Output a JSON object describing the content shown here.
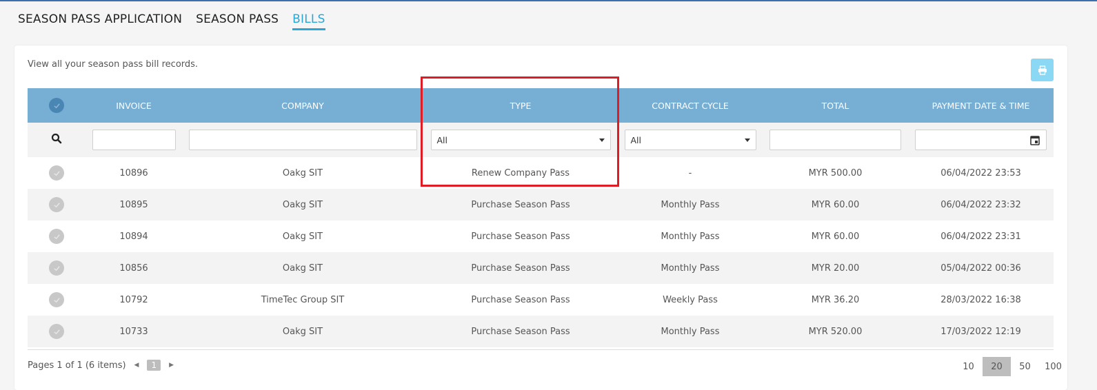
{
  "tabs": [
    {
      "label": "SEASON PASS APPLICATION",
      "active": false
    },
    {
      "label": "SEASON PASS",
      "active": false
    },
    {
      "label": "BILLS",
      "active": true
    }
  ],
  "description": "View all your season pass bill records.",
  "columns": [
    "INVOICE",
    "COMPANY",
    "TYPE",
    "CONTRACT CYCLE",
    "TOTAL",
    "PAYMENT DATE & TIME"
  ],
  "filters": {
    "type_value": "All",
    "contract_cycle_value": "All"
  },
  "rows": [
    {
      "invoice": "10896",
      "company": "Oakg SIT",
      "type": "Renew Company Pass",
      "cycle": "-",
      "total": "MYR 500.00",
      "date": "06/04/2022 23:53"
    },
    {
      "invoice": "10895",
      "company": "Oakg SIT",
      "type": "Purchase Season Pass",
      "cycle": "Monthly Pass",
      "total": "MYR 60.00",
      "date": "06/04/2022 23:32"
    },
    {
      "invoice": "10894",
      "company": "Oakg SIT",
      "type": "Purchase Season Pass",
      "cycle": "Monthly Pass",
      "total": "MYR 60.00",
      "date": "06/04/2022 23:31"
    },
    {
      "invoice": "10856",
      "company": "Oakg SIT",
      "type": "Purchase Season Pass",
      "cycle": "Monthly Pass",
      "total": "MYR 20.00",
      "date": "05/04/2022 00:36"
    },
    {
      "invoice": "10792",
      "company": "TimeTec Group SIT",
      "type": "Purchase Season Pass",
      "cycle": "Weekly Pass",
      "total": "MYR 36.20",
      "date": "28/03/2022 16:38"
    },
    {
      "invoice": "10733",
      "company": "Oakg SIT",
      "type": "Purchase Season Pass",
      "cycle": "Monthly Pass",
      "total": "MYR 520.00",
      "date": "17/03/2022 12:19"
    }
  ],
  "pager": {
    "info": "Pages 1 of 1 (6 items)",
    "current_page": "1",
    "page_sizes": [
      "10",
      "20",
      "50",
      "100"
    ],
    "active_size": "20"
  },
  "colors": {
    "accent": "#2aa6d6",
    "header": "#77aed3",
    "highlight": "#e01b24"
  },
  "icons": [
    "print-icon",
    "search-icon",
    "check-icon",
    "calendar-icon",
    "caret-down-icon",
    "arrow-left-icon",
    "arrow-right-icon"
  ]
}
